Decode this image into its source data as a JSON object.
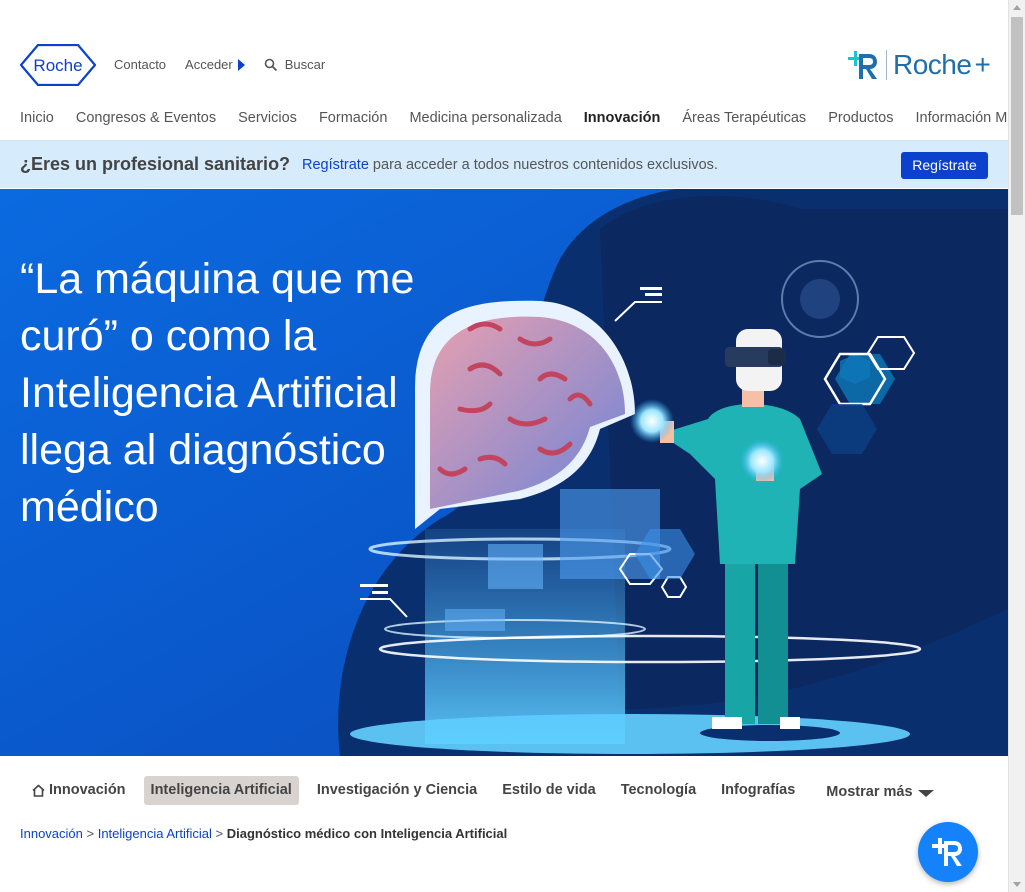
{
  "header": {
    "logo_text": "Roche",
    "top_links": {
      "contact": "Contacto",
      "login": "Acceder",
      "search_placeholder": "Buscar"
    },
    "brand_plus": "Roche",
    "brand_plus_suffix": "+"
  },
  "nav": {
    "items": [
      {
        "label": "Inicio"
      },
      {
        "label": "Congresos & Eventos"
      },
      {
        "label": "Servicios"
      },
      {
        "label": "Formación"
      },
      {
        "label": "Medicina personalizada"
      },
      {
        "label": "Innovación",
        "active": true
      },
      {
        "label": "Áreas Terapéuticas"
      },
      {
        "label": "Productos"
      },
      {
        "label": "Información Médica"
      }
    ]
  },
  "banner": {
    "question": "¿Eres un profesional sanitario?",
    "link": "Regístrate",
    "message": " para acceder a todos nuestros contenidos exclusivos.",
    "button": "Regístrate"
  },
  "hero": {
    "title": "“La máquina que me curó” o como la Inteligencia Artificial llega al diagnóstico médico"
  },
  "subnav": {
    "tabs": [
      {
        "label": "Innovación",
        "icon": "home-icon"
      },
      {
        "label": "Inteligencia Artificial",
        "active": true
      },
      {
        "label": "Investigación y Ciencia"
      },
      {
        "label": "Estilo de vida"
      },
      {
        "label": "Tecnología"
      },
      {
        "label": "Infografías"
      }
    ],
    "more": "Mostrar más"
  },
  "breadcrumb": {
    "items": [
      "Innovación",
      "Inteligencia Artificial"
    ],
    "separator": " > ",
    "current": "Diagnóstico médico con Inteligencia Artificial"
  },
  "colors": {
    "accent": "#0b41cd",
    "banner_bg": "#d6ecfc",
    "hero_bg": "#0c5bd2",
    "chat_button": "#1482fa"
  }
}
